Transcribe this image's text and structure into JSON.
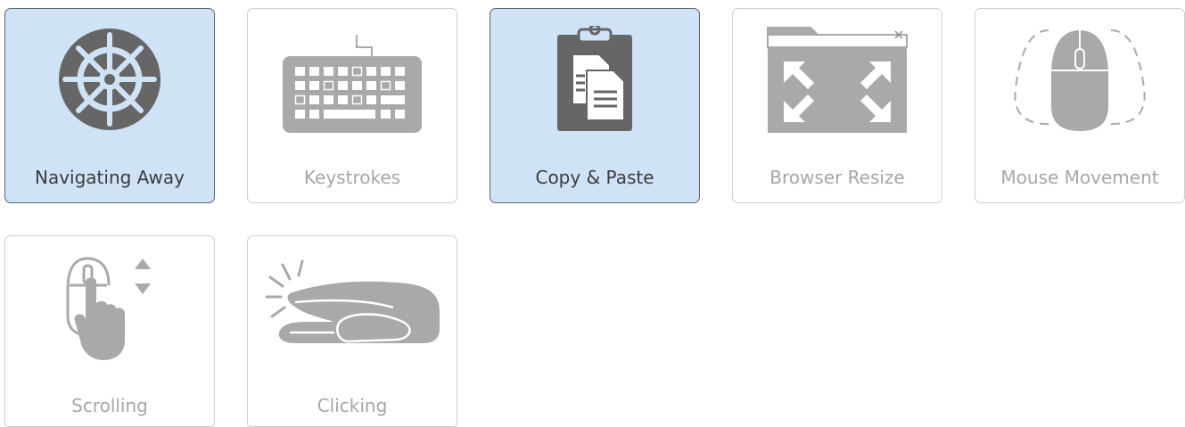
{
  "tiles": [
    {
      "label": "Navigating Away",
      "selected": true,
      "icon": "ship-wheel-icon"
    },
    {
      "label": "Keystrokes",
      "selected": false,
      "icon": "keyboard-icon"
    },
    {
      "label": "Copy & Paste",
      "selected": true,
      "icon": "clipboard-icon"
    },
    {
      "label": "Browser Resize",
      "selected": false,
      "icon": "browser-resize-icon"
    },
    {
      "label": "Mouse Movement",
      "selected": false,
      "icon": "mouse-movement-icon"
    },
    {
      "label": "Scrolling",
      "selected": false,
      "icon": "scroll-mouse-icon"
    },
    {
      "label": "Clicking",
      "selected": false,
      "icon": "clicking-hand-icon"
    }
  ],
  "colors": {
    "selected_bg": "#cfe2f6",
    "selected_border": "#5e6570",
    "icon_dark": "#666666",
    "icon_light": "#a9a9a9"
  }
}
